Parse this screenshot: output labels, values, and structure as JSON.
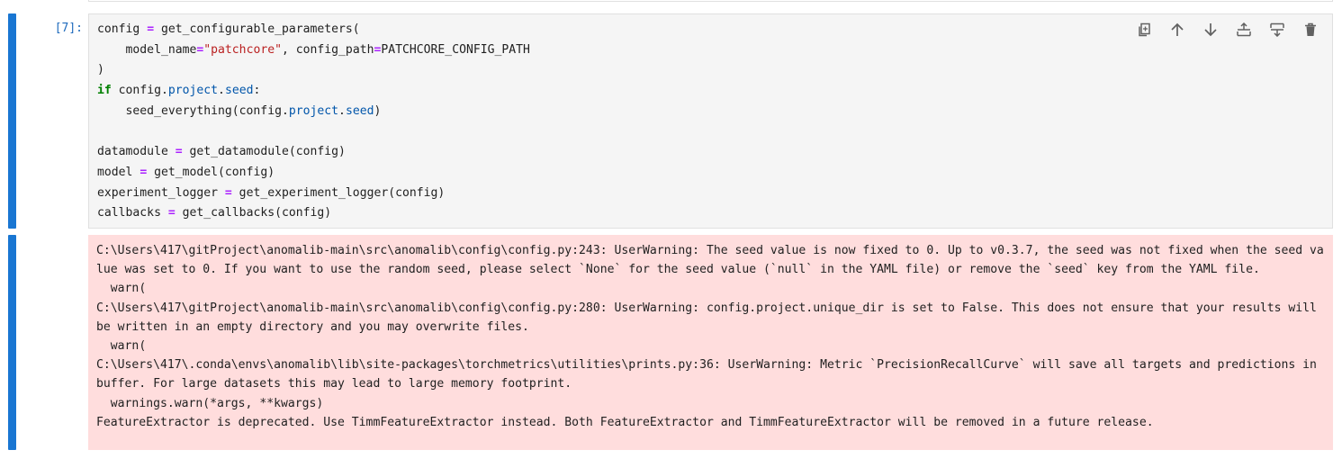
{
  "cell": {
    "prompt": "[7]:",
    "code_lines": [
      [
        {
          "t": "config "
        },
        {
          "t": "=",
          "c": "op"
        },
        {
          "t": " get_configurable_parameters("
        }
      ],
      [
        {
          "t": "    model_name"
        },
        {
          "t": "=",
          "c": "op"
        },
        {
          "t": "\"patchcore\"",
          "c": "str"
        },
        {
          "t": ", config_path"
        },
        {
          "t": "=",
          "c": "op"
        },
        {
          "t": "PATCHCORE_CONFIG_PATH"
        }
      ],
      [
        {
          "t": ")"
        }
      ],
      [
        {
          "t": "if",
          "c": "kw"
        },
        {
          "t": " config."
        },
        {
          "t": "project",
          "c": "attr"
        },
        {
          "t": "."
        },
        {
          "t": "seed",
          "c": "attr"
        },
        {
          "t": ":"
        }
      ],
      [
        {
          "t": "    seed_everything(config."
        },
        {
          "t": "project",
          "c": "attr"
        },
        {
          "t": "."
        },
        {
          "t": "seed",
          "c": "attr"
        },
        {
          "t": ")"
        }
      ],
      [
        {
          "t": ""
        }
      ],
      [
        {
          "t": "datamodule "
        },
        {
          "t": "=",
          "c": "op"
        },
        {
          "t": " get_datamodule(config)"
        }
      ],
      [
        {
          "t": "model "
        },
        {
          "t": "=",
          "c": "op"
        },
        {
          "t": " get_model(config)"
        }
      ],
      [
        {
          "t": "experiment_logger "
        },
        {
          "t": "=",
          "c": "op"
        },
        {
          "t": " get_experiment_logger(config)"
        }
      ],
      [
        {
          "t": "callbacks "
        },
        {
          "t": "=",
          "c": "op"
        },
        {
          "t": " get_callbacks(config)"
        }
      ]
    ],
    "toolbar": [
      {
        "name": "duplicate-cell-button",
        "icon": "duplicate-icon"
      },
      {
        "name": "move-up-button",
        "icon": "arrow-up-icon"
      },
      {
        "name": "move-down-button",
        "icon": "arrow-down-icon"
      },
      {
        "name": "insert-above-button",
        "icon": "insert-above-icon"
      },
      {
        "name": "insert-below-button",
        "icon": "insert-below-icon"
      },
      {
        "name": "delete-cell-button",
        "icon": "trash-icon"
      }
    ],
    "stderr": "C:\\Users\\417\\gitProject\\anomalib-main\\src\\anomalib\\config\\config.py:243: UserWarning: The seed value is now fixed to 0. Up to v0.3.7, the seed was not fixed when the seed value was set to 0. If you want to use the random seed, please select `None` for the seed value (`null` in the YAML file) or remove the `seed` key from the YAML file.\n  warn(\nC:\\Users\\417\\gitProject\\anomalib-main\\src\\anomalib\\config\\config.py:280: UserWarning: config.project.unique_dir is set to False. This does not ensure that your results will be written in an empty directory and you may overwrite files.\n  warn(\nC:\\Users\\417\\.conda\\envs\\anomalib\\lib\\site-packages\\torchmetrics\\utilities\\prints.py:36: UserWarning: Metric `PrecisionRecallCurve` will save all targets and predictions in buffer. For large datasets this may lead to large memory footprint.\n  warnings.warn(*args, **kwargs)\nFeatureExtractor is deprecated. Use TimmFeatureExtractor instead. Both FeatureExtractor and TimmFeatureExtractor will be removed in a future release."
  },
  "colors": {
    "active_bar": "#1976d2",
    "stderr_bg": "#ffdddd",
    "code_bg": "#f5f5f5"
  }
}
